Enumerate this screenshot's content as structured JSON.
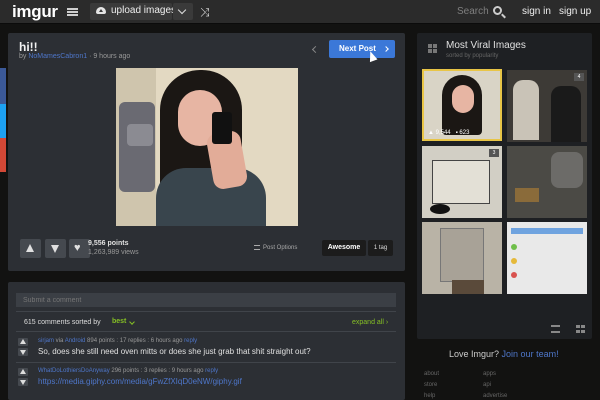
{
  "topbar": {
    "logo": "imgur",
    "upload_label": "upload images",
    "search_placeholder": "Search",
    "signin": "sign in",
    "signup": "sign up"
  },
  "post": {
    "title": "hi!!",
    "by": "by",
    "author": "NoMamesCabron1",
    "time": "· 9 hours ago",
    "next_label": "Next Post",
    "points": "9,556 points",
    "views": "1,263,989 views",
    "options_label": "Post Options",
    "tag_label": "Awesome",
    "tag_count": "1 tag"
  },
  "comments": {
    "input_placeholder": "Submit a comment",
    "count_label": "615 comments sorted by",
    "sort_value": "best",
    "expand_label": "expand all",
    "items": [
      {
        "user": "sirjam",
        "via_label": "via",
        "device": "Android",
        "stats": "894 points : 17 replies : 6 hours ago",
        "reply": "reply",
        "text": "So, does she still need oven mitts or does she just grab that shit straight out?"
      },
      {
        "user": "WhatDoLothiersDoAnyway",
        "stats": "296 points : 3 replies : 9 hours ago",
        "reply": "reply",
        "text": "https://media.giphy.com/media/gFwZfXIqD0eNW/giphy.gif"
      }
    ]
  },
  "sidebar": {
    "title": "Most Viral Images",
    "subtitle": "sorted by popularity",
    "thumbs": [
      {
        "badge": "",
        "stats_left": "9,544",
        "stats_right": "623"
      },
      {
        "badge": "4"
      },
      {
        "badge": "3"
      },
      {
        "badge": ""
      },
      {
        "badge": ""
      },
      {
        "badge": ""
      }
    ],
    "footer_love": "Love Imgur?",
    "footer_join": "Join our team!",
    "footer_links": [
      "about",
      "apps",
      "store",
      "api",
      "help",
      "advertise"
    ]
  },
  "colors": {
    "accent_blue": "#3b78d8",
    "link_blue": "#4e76c9",
    "green": "#85bf25",
    "background": "#121211",
    "panel": "#2c2f34"
  }
}
